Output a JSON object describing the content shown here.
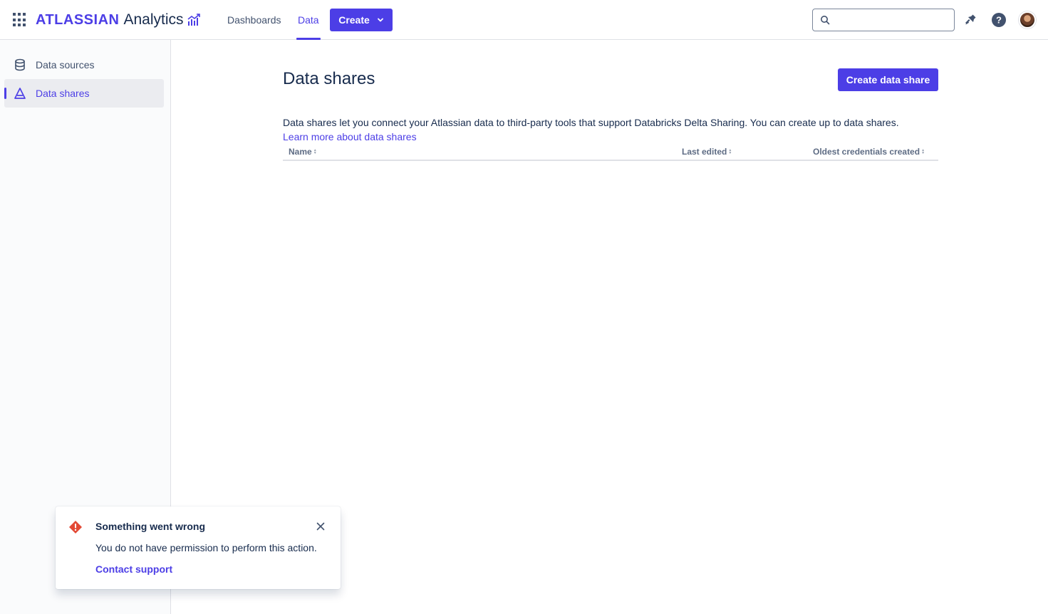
{
  "header": {
    "brand": "ATLASSIAN",
    "product": "Analytics",
    "nav": [
      {
        "label": "Dashboards",
        "active": false
      },
      {
        "label": "Data",
        "active": true
      }
    ],
    "create_label": "Create",
    "search_placeholder": ""
  },
  "sidebar": {
    "items": [
      {
        "label": "Data sources",
        "icon": "database-icon",
        "active": false
      },
      {
        "label": "Data shares",
        "icon": "delta-share-icon",
        "active": true
      }
    ]
  },
  "main": {
    "title": "Data shares",
    "create_button": "Create data share",
    "description": "Data shares let you connect your Atlassian data to third-party tools that support Databricks Delta Sharing. You can create up to data shares.",
    "learn_more": "Learn more about data shares",
    "table": {
      "columns": [
        "Name",
        "Last edited",
        "Oldest credentials created"
      ],
      "rows": []
    }
  },
  "flag": {
    "title": "Something went wrong",
    "body": "You do not have permission to perform this action.",
    "action": "Contact support",
    "status_color": "#e34935"
  },
  "colors": {
    "accent": "#4c3ee6",
    "text": "#172b4d",
    "subtle": "#42526e"
  }
}
